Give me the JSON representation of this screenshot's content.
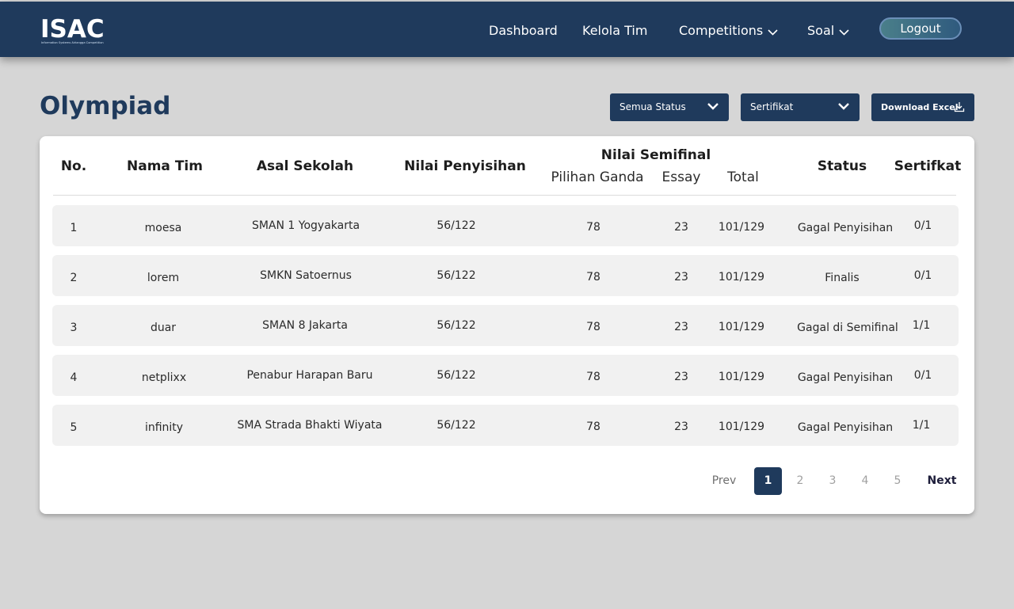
{
  "navbar": {
    "logo_text": "ISAC",
    "logo_tagline": "Information Systems Airlangga Competition",
    "links": {
      "dashboard": "Dashboard",
      "kelola_tim": "Kelola Tim",
      "competitions": "Competitions",
      "soal": "Soal"
    },
    "logout": "Logout"
  },
  "page": {
    "title": "Olympiad",
    "filters": {
      "status": "Semua Status",
      "sertifikat": "Sertifikat"
    },
    "download_label": "Download Excel"
  },
  "table": {
    "headers": {
      "no": "No.",
      "nama_tim": "Nama Tim",
      "asal_sekolah": "Asal Sekolah",
      "nilai_penyisihan": "Nilai Penyisihan",
      "nilai_semifinal": "Nilai Semifinal",
      "pilihan_ganda": "Pilihan Ganda",
      "essay": "Essay",
      "total": "Total",
      "status": "Status",
      "sertifikat": "Sertifkat"
    },
    "rows": [
      {
        "no": "1",
        "nama": "moesa",
        "sekolah": "SMAN 1 Yogyakarta",
        "penyisihan": "56/122",
        "pg": "78",
        "essay": "23",
        "total": "101/129",
        "status": "Gagal Penyisihan",
        "sertifikat": "0/1"
      },
      {
        "no": "2",
        "nama": "lorem",
        "sekolah": "SMKN Satoernus",
        "penyisihan": "56/122",
        "pg": "78",
        "essay": "23",
        "total": "101/129",
        "status": "Finalis",
        "sertifikat": "0/1"
      },
      {
        "no": "3",
        "nama": "duar",
        "sekolah": "SMAN 8 Jakarta",
        "penyisihan": "56/122",
        "pg": "78",
        "essay": "23",
        "total": "101/129",
        "status": "Gagal di Semifinal",
        "sertifikat": "1/1"
      },
      {
        "no": "4",
        "nama": "netplixx",
        "sekolah": "Penabur Harapan Baru",
        "penyisihan": "56/122",
        "pg": "78",
        "essay": "23",
        "total": "101/129",
        "status": "Gagal Penyisihan",
        "sertifikat": "0/1"
      },
      {
        "no": "5",
        "nama": "infinity",
        "sekolah": "SMA Strada Bhakti Wiyata",
        "penyisihan": "56/122",
        "pg": "78",
        "essay": "23",
        "total": "101/129",
        "status": "Gagal Penyisihan",
        "sertifikat": "1/1"
      }
    ]
  },
  "pagination": {
    "prev": "Prev",
    "pages": [
      "1",
      "2",
      "3",
      "4",
      "5"
    ],
    "current": "1",
    "next": "Next"
  },
  "colors": {
    "navy": "#1f3a5c",
    "background": "#d6d6d6",
    "row_bg": "#f1f1f1"
  }
}
